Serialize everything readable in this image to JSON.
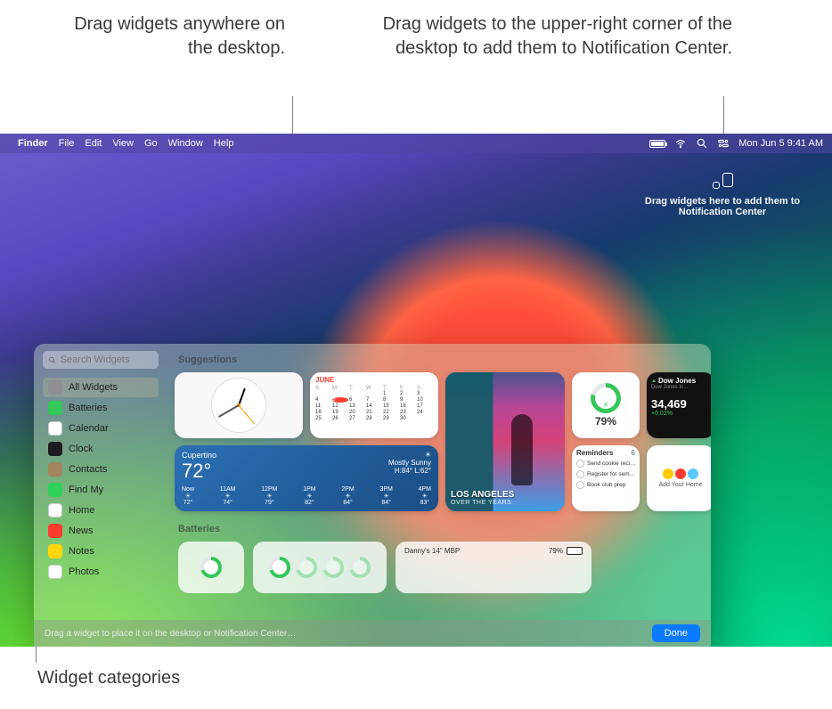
{
  "annotations": {
    "drag_desktop": "Drag widgets anywhere on the desktop.",
    "drag_nc": "Drag widgets to the upper-right corner of the desktop to add them to Notification Center.",
    "categories_label": "Widget categories"
  },
  "menubar": {
    "app": "Finder",
    "items": [
      "File",
      "Edit",
      "View",
      "Go",
      "Window",
      "Help"
    ],
    "clock": "Mon Jun 5  9:41 AM"
  },
  "nc_drop": {
    "text": "Drag widgets here to add them to Notification Center"
  },
  "gallery": {
    "search_placeholder": "Search Widgets",
    "categories": [
      {
        "label": "All Widgets",
        "color": "#8e8e93",
        "selected": true
      },
      {
        "label": "Batteries",
        "color": "#34c759"
      },
      {
        "label": "Calendar",
        "color": "#ffffff"
      },
      {
        "label": "Clock",
        "color": "#1c1c1e"
      },
      {
        "label": "Contacts",
        "color": "#a2845e"
      },
      {
        "label": "Find My",
        "color": "#30d158"
      },
      {
        "label": "Home",
        "color": "#ffffff"
      },
      {
        "label": "News",
        "color": "#ff3b30"
      },
      {
        "label": "Notes",
        "color": "#ffd60a"
      },
      {
        "label": "Photos",
        "color": "#ffffff"
      }
    ],
    "sections": {
      "suggestions": "Suggestions",
      "batteries": "Batteries"
    },
    "widgets": {
      "calendar": {
        "month": "June",
        "day_initials": [
          "S",
          "M",
          "T",
          "W",
          "T",
          "F",
          "S"
        ]
      },
      "weather": {
        "city": "Cupertino",
        "temp": "72°",
        "cond": "Mostly Sunny",
        "range": "H:84° L:62°",
        "hours": [
          {
            "t": "Now",
            "d": "72°"
          },
          {
            "t": "11AM",
            "d": "74°"
          },
          {
            "t": "12PM",
            "d": "79°"
          },
          {
            "t": "1PM",
            "d": "82°"
          },
          {
            "t": "2PM",
            "d": "84°"
          },
          {
            "t": "3PM",
            "d": "84°"
          },
          {
            "t": "4PM",
            "d": "83°"
          }
        ]
      },
      "photos": {
        "title": "LOS ANGELES",
        "subtitle": "OVER THE YEARS"
      },
      "battery": {
        "percent": "79%"
      },
      "stocks": {
        "name": "Dow Jones",
        "sub": "Dow Jones In...",
        "value": "34,469",
        "change": "+0.02%"
      },
      "reminders": {
        "title": "Reminders",
        "count": "6",
        "items": [
          "Send cookie reci…",
          "Register for sem…",
          "Book club prep"
        ]
      },
      "home": {
        "label": "Add Your Home"
      },
      "batt_lg": {
        "device": "Danny's 14\" MBP",
        "pct": "79%"
      }
    },
    "footer_hint": "Drag a widget to place it on the desktop or Notification Center…",
    "done": "Done"
  }
}
